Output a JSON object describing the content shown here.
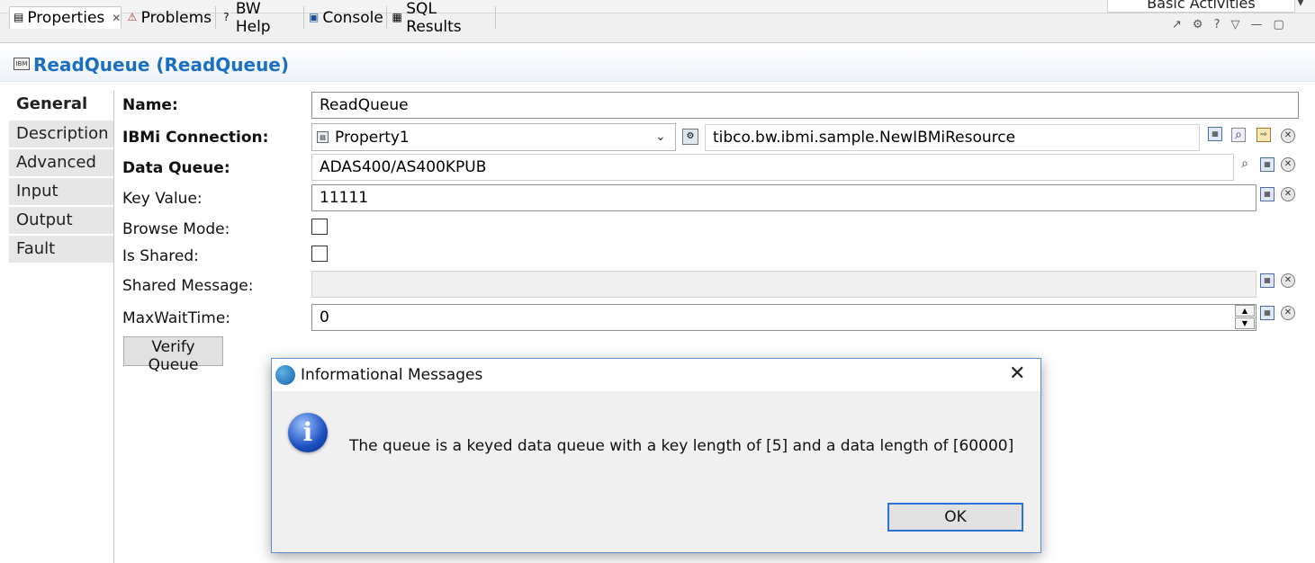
{
  "top": {
    "palette_label": "Basic Activities"
  },
  "tabs": [
    {
      "label": "Properties",
      "icon": "properties-icon"
    },
    {
      "label": "Problems",
      "icon": "problems-icon"
    },
    {
      "label": "BW Help",
      "icon": "help-icon"
    },
    {
      "label": "Console",
      "icon": "console-icon"
    },
    {
      "label": "SQL Results",
      "icon": "sql-results-icon"
    }
  ],
  "header": {
    "title": "ReadQueue (ReadQueue)"
  },
  "nav": {
    "items": [
      "General",
      "Description",
      "Advanced",
      "Input",
      "Output",
      "Fault"
    ],
    "active": "General"
  },
  "form": {
    "name_label": "Name:",
    "name_value": "ReadQueue",
    "connection_label": "IBMi Connection:",
    "connection_property": "Property1",
    "connection_resource": "tibco.bw.ibmi.sample.NewIBMiResource",
    "dataqueue_label": "Data Queue:",
    "dataqueue_value": "ADAS400/AS400KPUB",
    "keyvalue_label": "Key Value:",
    "keyvalue_value": "11111",
    "browse_label": "Browse Mode:",
    "shared_label": "Is Shared:",
    "sharedmsg_label": "Shared Message:",
    "sharedmsg_value": "",
    "maxwait_label": "MaxWaitTime:",
    "maxwait_value": "0",
    "verify_button": "Verify Queue"
  },
  "dialog": {
    "title": "Informational Messages",
    "message": "The queue is a keyed data queue with a key length of [5] and a data length of [60000]",
    "ok_label": "OK"
  }
}
